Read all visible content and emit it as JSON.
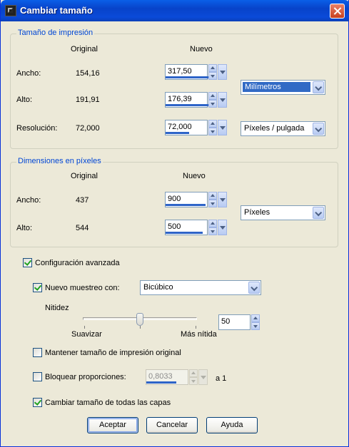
{
  "window": {
    "title": "Cambiar tamaño",
    "icon": "app-icon",
    "close_icon": "close-icon"
  },
  "print_size": {
    "group_label": "Tamaño de impresión",
    "col_original": "Original",
    "col_new": "Nuevo",
    "rows": [
      {
        "label": "Ancho:",
        "original": "154,16",
        "new_value": "317,50",
        "level": 0.95
      },
      {
        "label": "Alto:",
        "original": "191,91",
        "new_value": "176,39",
        "level": 0.85
      },
      {
        "label": "Resolución:",
        "original": "72,000",
        "new_value": "72,000",
        "level": 0.45
      }
    ],
    "unit_select": "Milímetros",
    "resolution_unit_select": "Píxeles / pulgada"
  },
  "pixel_dimensions": {
    "group_label": "Dimensiones en píxeles",
    "col_original": "Original",
    "col_new": "Nuevo",
    "rows": [
      {
        "label": "Ancho:",
        "original": "437",
        "new_value": "900",
        "level": 0.75
      },
      {
        "label": "Alto:",
        "original": "544",
        "new_value": "500",
        "level": 0.7
      }
    ],
    "unit_select": "Píxeles"
  },
  "advanced": {
    "advanced_settings_label": "Configuración avanzada",
    "advanced_settings_checked": true,
    "resample_label": "Nuevo muestreo con:",
    "resample_checked": true,
    "resample_method": "Bicúbico",
    "sharpness_label": "Nitidez",
    "smooth_label": "Suavizar",
    "sharper_label": "Más nítida",
    "sharpness_value": "50",
    "keep_print_size_label": "Mantener tamaño de impresión original",
    "keep_print_size_checked": false,
    "lock_ratio_label": "Bloquear proporciones:",
    "lock_ratio_checked": false,
    "ratio_value": "0,8033",
    "ratio_suffix": "a 1",
    "resize_all_layers_label": "Cambiar tamaño de todas las capas",
    "resize_all_layers_checked": true
  },
  "buttons": {
    "ok": "Aceptar",
    "cancel": "Cancelar",
    "help": "Ayuda"
  }
}
